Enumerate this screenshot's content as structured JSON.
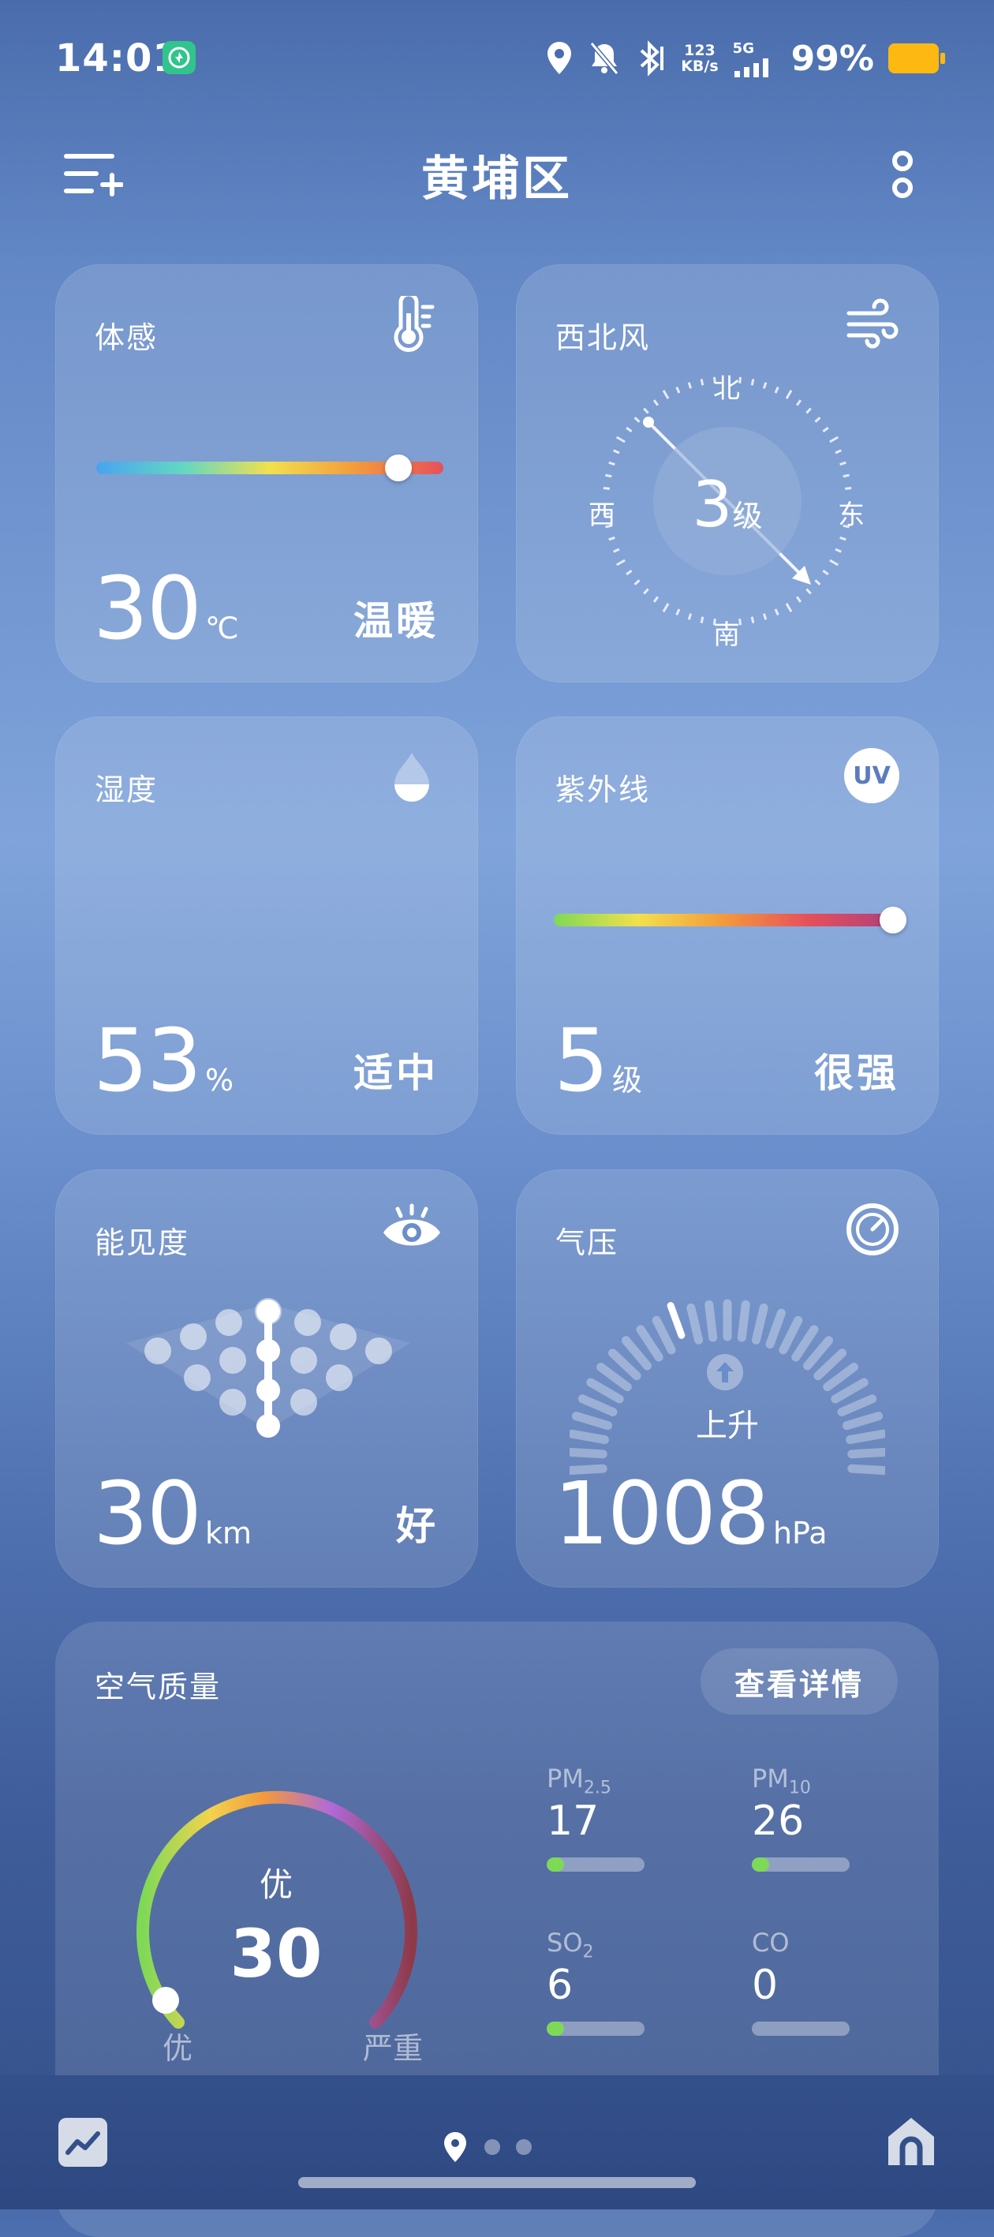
{
  "status_bar": {
    "time": "14:01",
    "net_speed_value": "123",
    "net_speed_unit": "KB/s",
    "network": "5G",
    "battery": "99%",
    "battery_color": "#fdb912"
  },
  "header": {
    "title": "黄埔区",
    "left_icon": "add-city-list-icon",
    "right_icon": "more-vertical-icon"
  },
  "feels_like": {
    "title": "体感",
    "icon": "thermometer-icon",
    "value": "30",
    "unit": "℃",
    "label": "温暖",
    "level": 0.87
  },
  "wind": {
    "title": "西北风",
    "icon": "wind-icon",
    "level": "3",
    "level_unit": "级",
    "north": "北",
    "south": "南",
    "west": "西",
    "east": "东"
  },
  "humidity": {
    "title": "湿度",
    "icon": "water-drop-icon",
    "value": "53",
    "unit": "%",
    "label": "适中"
  },
  "uv": {
    "title": "紫外线",
    "icon": "uv-icon",
    "icon_text": "UV",
    "value": "5",
    "unit": "级",
    "label": "很强",
    "level": 1.0
  },
  "visibility": {
    "title": "能见度",
    "icon": "eye-icon",
    "value": "30",
    "unit": "km",
    "label": "好"
  },
  "pressure": {
    "title": "气压",
    "icon": "gauge-icon",
    "trend": "上升",
    "value": "1008",
    "unit": "hPa"
  },
  "air_quality": {
    "title": "空气质量",
    "detail_button": "查看详情",
    "level": "优",
    "aqi": "30",
    "scale_min_label": "优",
    "scale_max_label": "严重",
    "pollutants": [
      {
        "name": "PM",
        "sub": "2.5",
        "value": "17",
        "fill": 0.18
      },
      {
        "name": "PM",
        "sub": "10",
        "value": "26",
        "fill": 0.18
      },
      {
        "name": "SO",
        "sub": "2",
        "value": "6",
        "fill": 0.18
      },
      {
        "name": "CO",
        "sub": "",
        "value": "0",
        "fill": 0
      }
    ]
  },
  "bottom_nav": {
    "left_icon": "trend-chart-icon",
    "right_icon": "home-icon",
    "page_dots": 3,
    "active_page": 0
  }
}
